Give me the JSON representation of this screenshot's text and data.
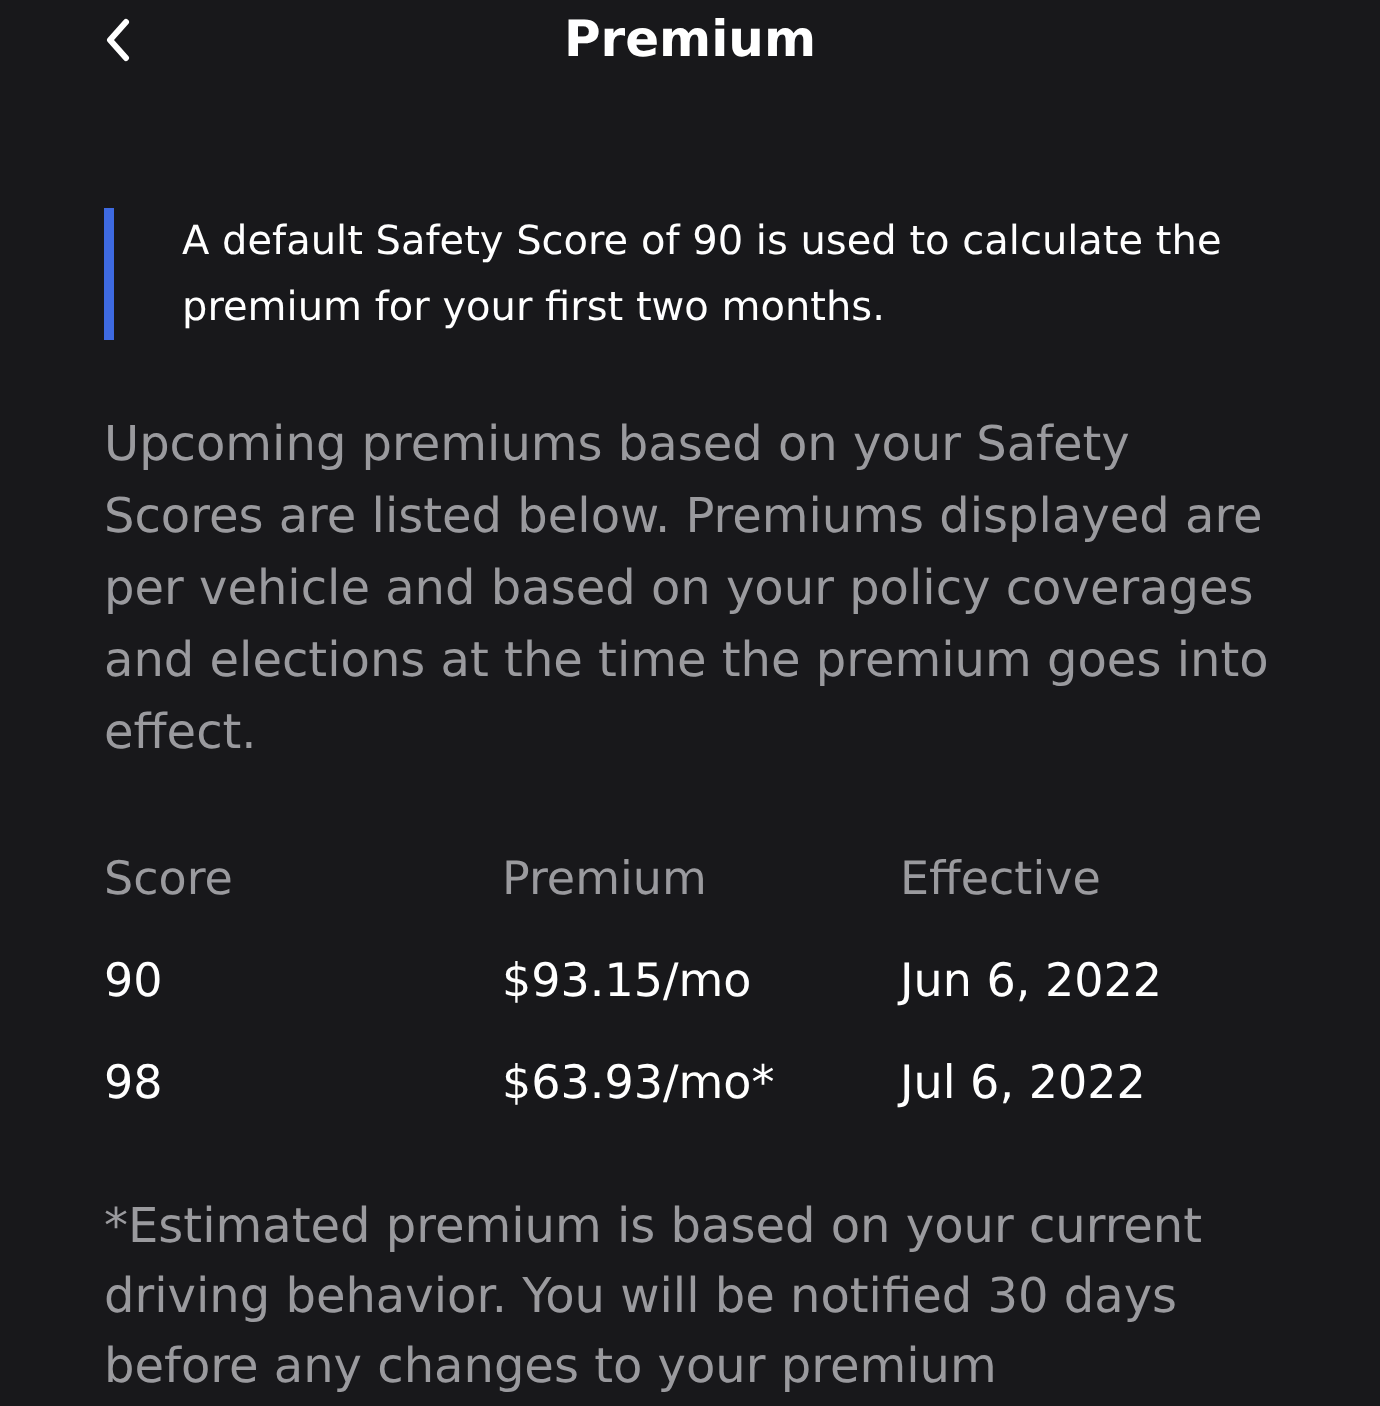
{
  "header": {
    "title": "Premium"
  },
  "notice": {
    "text": "A default Safety Score of 90 is used to calculate the premium for your first two months."
  },
  "description": "Upcoming premiums based on your Safety Scores are listed below. Premiums displayed are per vehicle and based on your policy coverages and elections at the time the premium goes into effect.",
  "table": {
    "columns": [
      "Score",
      "Premium",
      "Effective"
    ],
    "rows": [
      [
        "90",
        "$93.15/mo",
        "Jun 6, 2022"
      ],
      [
        "98",
        "$63.93/mo*",
        "Jul 6, 2022"
      ]
    ]
  },
  "footnote": "*Estimated premium is based on your current driving behavior. You will be notified 30 days before any changes to your premium"
}
